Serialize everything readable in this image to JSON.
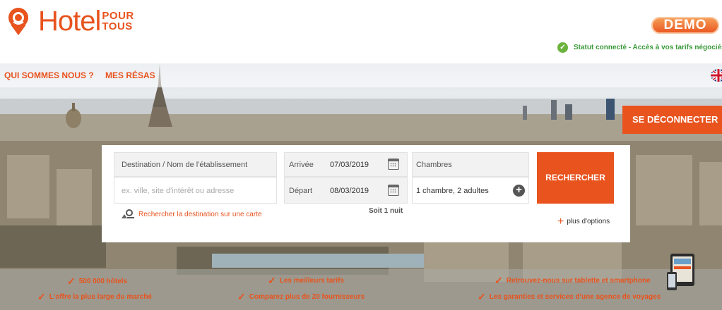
{
  "brand": {
    "name_part1": "Hotel",
    "name_part2a": "POUR",
    "name_part2b": "TOUS",
    "accent": "#e8531e"
  },
  "header": {
    "demo_label": "DEMO",
    "status_text": "Statut connecté - Accès à vos tarifs négociés"
  },
  "nav": {
    "items": [
      {
        "label": "QUI SOMMES NOUS ?"
      },
      {
        "label": "MES RÉSAS"
      }
    ],
    "language_icon": "uk-flag-icon",
    "logout_label": "SE DÉCONNECTER"
  },
  "search": {
    "destination_label": "Destination / Nom de l'établissement",
    "destination_placeholder": "ex. ville, site d'intérêt ou adresse",
    "arrival_label": "Arrivée",
    "arrival_value": "07/03/2019",
    "departure_label": "Départ",
    "departure_value": "08/03/2019",
    "rooms_label": "Chambres",
    "rooms_value": "1 chambre, 2 adultes",
    "search_button": "RECHERCHER",
    "map_link": "Rechercher la destination sur une carte",
    "nights_text": "Soit 1 nuit",
    "more_options": "plus d'options"
  },
  "features": [
    {
      "label": "500 000 hôtels"
    },
    {
      "label": "L'offre la plus large du marché"
    },
    {
      "label": "Les meilleurs tarifs"
    },
    {
      "label": "Comparez plus de 20 fournisseurs"
    },
    {
      "label": "Retrouvez-nous sur tablette et smartphone"
    },
    {
      "label": "Les garanties et services d'une agence de voyages"
    }
  ]
}
